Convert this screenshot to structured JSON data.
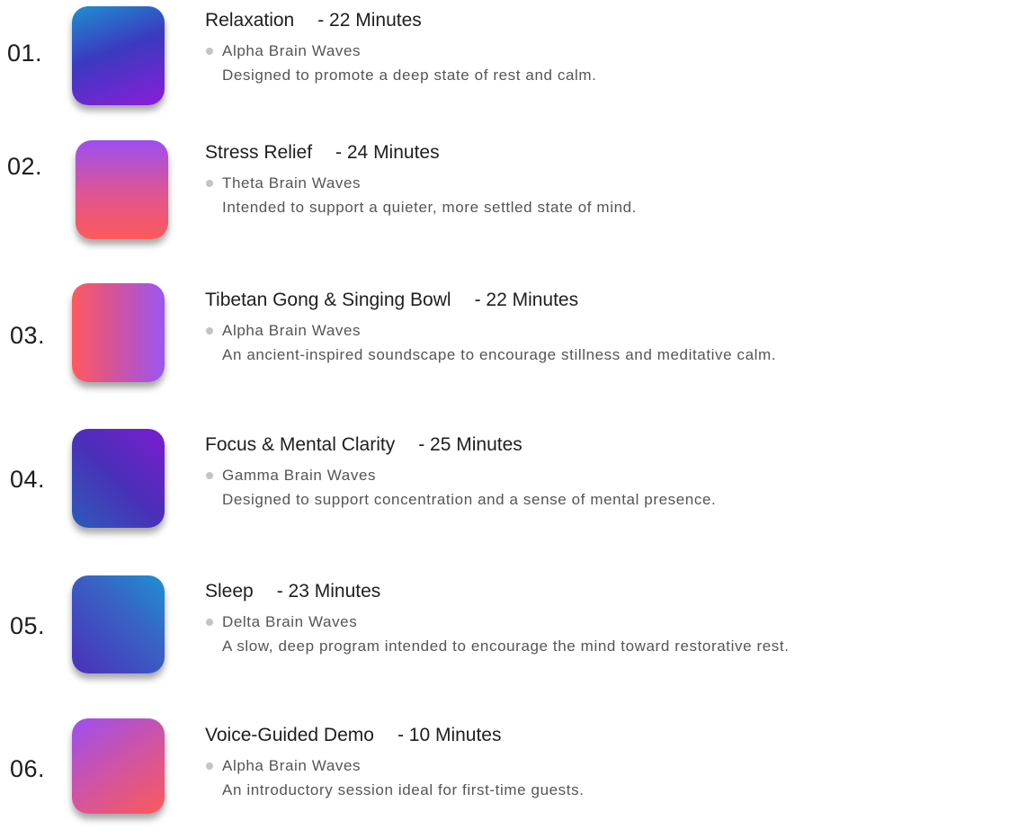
{
  "sessions": [
    {
      "number": "01.",
      "title": "Relaxation",
      "duration": "- 22 Minutes",
      "wave": "Alpha Brain Waves",
      "description": "Designed to promote a deep state of rest and calm.",
      "gradient": [
        "#1f8fd0",
        "#3a3ac0",
        "#8a1ed8"
      ]
    },
    {
      "number": "02.",
      "title": "Stress Relief",
      "duration": "- 24 Minutes",
      "wave": "Theta Brain Waves",
      "description": "Intended to support a quieter, more settled state of mind.",
      "gradient": [
        "#9c4ff0",
        "#e05590",
        "#fc5a5a"
      ]
    },
    {
      "number": "03.",
      "title": "Tibetan Gong & Singing Bowl",
      "duration": "- 22 Minutes",
      "wave": "Alpha Brain Waves",
      "description": "An ancient-inspired soundscape to encourage stillness and meditative calm.",
      "gradient": [
        "#ff5a5e",
        "#d4539a",
        "#9a56f2"
      ]
    },
    {
      "number": "04.",
      "title": "Focus & Mental Clarity",
      "duration": "- 25 Minutes",
      "wave": "Gamma Brain Waves",
      "description": "Designed to support concentration and a sense of mental presence.",
      "gradient": [
        "#2d5bb8",
        "#4a2fb8",
        "#7a1ccf"
      ]
    },
    {
      "number": "05.",
      "title": "Sleep",
      "duration": "- 23 Minutes",
      "wave": "Delta Brain Waves",
      "description": "A slow, deep program intended to encourage the mind toward restorative rest.",
      "gradient": [
        "#1f8fd0",
        "#3b5ec4",
        "#4a30b8"
      ]
    },
    {
      "number": "06.",
      "title": "Voice-Guided Demo",
      "duration": "- 10 Minutes",
      "wave": "Alpha Brain Waves",
      "description": "An introductory session ideal for first-time guests.",
      "gradient": [
        "#9c4ff0",
        "#d4549c",
        "#fc5a5a"
      ]
    }
  ],
  "colors": {
    "bullet": "#c4c4c4",
    "title_text": "#1e1e1e",
    "body_text": "#555555"
  }
}
